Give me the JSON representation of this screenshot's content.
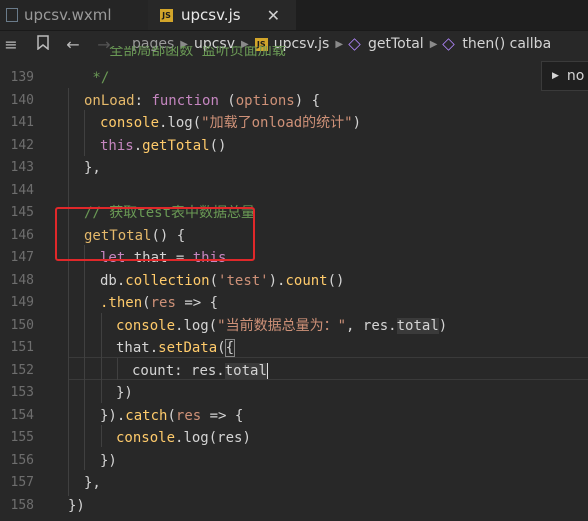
{
  "tabs": [
    {
      "label": "upcsv.wxml",
      "icon": "xml-file-icon",
      "active": false
    },
    {
      "label": "upcsv.js",
      "icon": "js-file-icon",
      "active": true
    }
  ],
  "breadcrumb": {
    "items": [
      "pages",
      "upcsv",
      "upcsv.js",
      "getTotal",
      "then() callba"
    ]
  },
  "popup": {
    "text": "no"
  },
  "line_numbers": [
    "139",
    "140",
    "141",
    "142",
    "143",
    "144",
    "145",
    "146",
    "147",
    "148",
    "149",
    "150",
    "151",
    "152",
    "153",
    "154",
    "155",
    "156",
    "157",
    "158"
  ],
  "code": {
    "l138": "   全部局部函数 监听页面加载",
    "l139": " */",
    "l140a": "onLoad",
    "l140b": ": ",
    "l140c": "function",
    "l140d": " (",
    "l140e": "options",
    "l140f": ") {",
    "l141a": "console",
    "l141b": ".log(",
    "l141c": "\"加载了onload的统计\"",
    "l141d": ")",
    "l142a": "this",
    "l142b": ".",
    "l142c": "getTotal",
    "l142d": "()",
    "l143": "},",
    "l145": "// 获取test表中数据总量",
    "l146a": "getTotal",
    "l146b": "() {",
    "l147a": "let",
    "l147b": " that = ",
    "l147c": "this",
    "l148a": "db.",
    "l148b": "collection",
    "l148c": "(",
    "l148d": "'test'",
    "l148e": ").",
    "l148f": "count",
    "l148g": "()",
    "l149a": ".then",
    "l149b": "(",
    "l149c": "res",
    "l149d": " => {",
    "l150a": "console",
    "l150b": ".log(",
    "l150c": "\"当前数据总量为：\"",
    "l150d": ", res.",
    "l150e": "total",
    "l150f": ")",
    "l151a": "that",
    "l151b": ".",
    "l151c": "setData",
    "l151d": "(",
    "l151e": "{",
    "l152a": "count",
    "l152b": ": res.",
    "l152c": "total",
    "l153": "})",
    "l154a": "}).",
    "l154b": "catch",
    "l154c": "(",
    "l154d": "res",
    "l154e": " => {",
    "l155a": "console",
    "l155b": ".log(res)",
    "l156": "})",
    "l157": "},",
    "l158": "})"
  }
}
